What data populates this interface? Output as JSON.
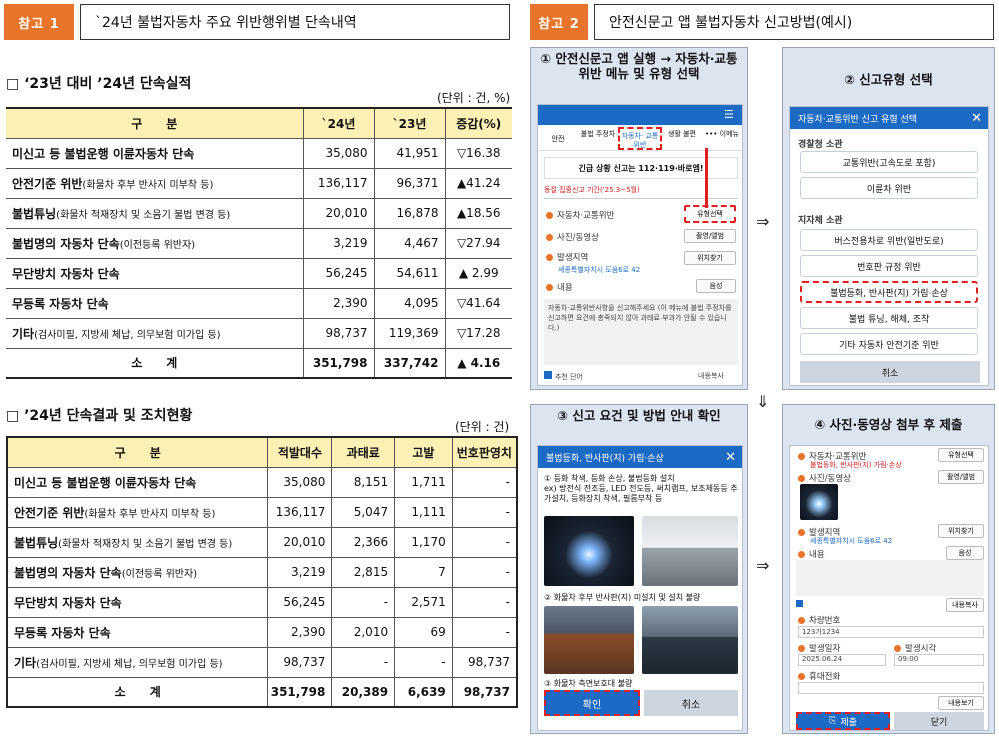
{
  "left": {
    "tag": "참고 1",
    "title": "`24년 불법자동차 주요 위반행위별 단속내역",
    "sec1": {
      "heading": "□ ‘23년 대비 ’24년 단속실적",
      "unit": "(단위 : 건, %)",
      "headers": [
        "구　　분",
        "`24년",
        "`23년",
        "증감(%)"
      ],
      "rows": [
        {
          "main": "미신고 등 불법운행 이륜자동차 단속",
          "sub": "",
          "y24": "35,080",
          "y23": "41,951",
          "chg": "▽16.38"
        },
        {
          "main": "안전기준 위반",
          "sub": "(화물차 후부 반사지 미부착 등)",
          "y24": "136,117",
          "y23": "96,371",
          "chg": "▲41.24"
        },
        {
          "main": "불법튜닝",
          "sub": "(화물차 적재장치 및 소음기 불법 변경 등)",
          "y24": "20,010",
          "y23": "16,878",
          "chg": "▲18.56"
        },
        {
          "main": "불법명의 자동차 단속",
          "sub": "(이전등록 위반자)",
          "y24": "3,219",
          "y23": "4,467",
          "chg": "▽27.94"
        },
        {
          "main": "무단방치 자동차 단속",
          "sub": "",
          "y24": "56,245",
          "y23": "54,611",
          "chg": "▲ 2.99"
        },
        {
          "main": "무등록 자동차 단속",
          "sub": "",
          "y24": "2,390",
          "y23": "4,095",
          "chg": "▽41.64"
        },
        {
          "main": "기타",
          "sub": "(검사미필, 지방세 체납, 의무보험 미가입 등)",
          "y24": "98,737",
          "y23": "119,369",
          "chg": "▽17.28"
        }
      ],
      "total": {
        "label": "소　　계",
        "y24": "351,798",
        "y23": "337,742",
        "chg": "▲ 4.16"
      }
    },
    "sec2": {
      "heading": "□ ’24년 단속결과 및 조치현황",
      "unit": "(단위 : 건)",
      "headers": [
        "구　　분",
        "적발대수",
        "과태료",
        "고발",
        "번호판영치"
      ],
      "rows": [
        {
          "main": "미신고 등 불법운행 이륜자동차 단속",
          "sub": "",
          "a": "35,080",
          "b": "8,151",
          "c": "1,711",
          "d": "-"
        },
        {
          "main": "안전기준 위반",
          "sub": "(화물차 후부 반사지 미부착 등)",
          "a": "136,117",
          "b": "5,047",
          "c": "1,111",
          "d": "-"
        },
        {
          "main": "불법튜닝",
          "sub": "(화물차 적재장치 및 소음기 불법 변경 등)",
          "a": "20,010",
          "b": "2,366",
          "c": "1,170",
          "d": "-"
        },
        {
          "main": "불법명의 자동차 단속",
          "sub": "(이전등록 위반자)",
          "a": "3,219",
          "b": "2,815",
          "c": "7",
          "d": "-"
        },
        {
          "main": "무단방치 자동차 단속",
          "sub": "",
          "a": "56,245",
          "b": "-",
          "c": "2,571",
          "d": "-"
        },
        {
          "main": "무등록 자동차 단속",
          "sub": "",
          "a": "2,390",
          "b": "2,010",
          "c": "69",
          "d": "-"
        },
        {
          "main": "기타",
          "sub": "(검사미필, 지방세 체납, 의무보험 미가입 등)",
          "a": "98,737",
          "b": "-",
          "c": "-",
          "d": "98,737"
        }
      ],
      "total": {
        "label": "소　　계",
        "a": "351,798",
        "b": "20,389",
        "c": "6,639",
        "d": "98,737"
      }
    }
  },
  "right": {
    "tag": "참고 2",
    "title": "안전신문고 앱 불법자동차 신고방법(예시)",
    "p1": {
      "title": "① 안전신문고 앱 실행 → 자동차·교통위반 메뉴 및 유형 선택",
      "tabs": [
        "안전",
        "불법 주정차",
        "자동차· 교통위반",
        "생활 불편",
        "••• 이메뉴"
      ],
      "banner": "긴급 상황 신고는 112·119·바로엠!",
      "period": "동절 집중신고 기간('25.3~5월)",
      "items": [
        "자동차·교통위반",
        "사진/동영상",
        "발생지역",
        "내용"
      ],
      "buttons": [
        "유형선택",
        "촬영/앨범",
        "위치찾기",
        "음성"
      ],
      "addr": "세종특별자치시 도움6로 42",
      "content": "자동차·교통위반사항을 신고해주세요 (이 메뉴에 불법 주정차를 신고하면 요건에 충족되지 않아 과태료 부과가 안될 수 있습니다.)",
      "check": "추천 단어",
      "copy": "내용복사"
    },
    "p2": {
      "title": "② 신고유형 선택",
      "bar": "자동차·교통위반 신고 유형 선택",
      "police": "경찰청 소관",
      "police_items": [
        "교통위반(고속도로 포함)",
        "이륜차 위반"
      ],
      "local": "지자체 소관",
      "local_items": [
        "버스전용차로 위반(일반도로)",
        "번호판 규정 위반",
        "불법등화, 반사판(지) 가림·손상",
        "불법 튜닝, 해체, 조작",
        "기타 자동차 안전기준 위반"
      ],
      "cancel": "취소"
    },
    "p3": {
      "title": "③ 신고 요건 및 방법 안내 확인",
      "bar": "불법등화, 반사판(지) 가림·손상",
      "t1": "① 등화 착색, 등화 손상, 불법등화 설치",
      "t1b": "ex) 방전식 전조등, LED 전도등, 써치램프, 보조제동등 추가설치, 등화장치 착색, 필름부착 등",
      "t2": "② 화물차 후부 반사판(지) 미설치 및 설치 불량",
      "t3": "③ 화물차 측면보호대 불량",
      "ok": "확인",
      "cancel": "취소"
    },
    "p4": {
      "title": "④ 사진·동영상 첨부 후 제출",
      "items": [
        "자동차·교통위반",
        "사진/동영상",
        "발생지역",
        "내용",
        "차량번호",
        "발생일자",
        "발생시각",
        "휴대전화"
      ],
      "sub1": "불법등화, 반사판(지) 가림·손상",
      "addr": "세종특별자치시 도움6로 42",
      "plate": "123가1234",
      "date": "2025.06.24",
      "time": "09:00",
      "buttons": [
        "유형선택",
        "촬영/앨범",
        "위치찾기",
        "음성",
        "내용복사",
        "내용보기"
      ],
      "submit": "제출",
      "close": "닫기"
    },
    "arrows": [
      "⇒",
      "⇓",
      "⇒"
    ]
  }
}
